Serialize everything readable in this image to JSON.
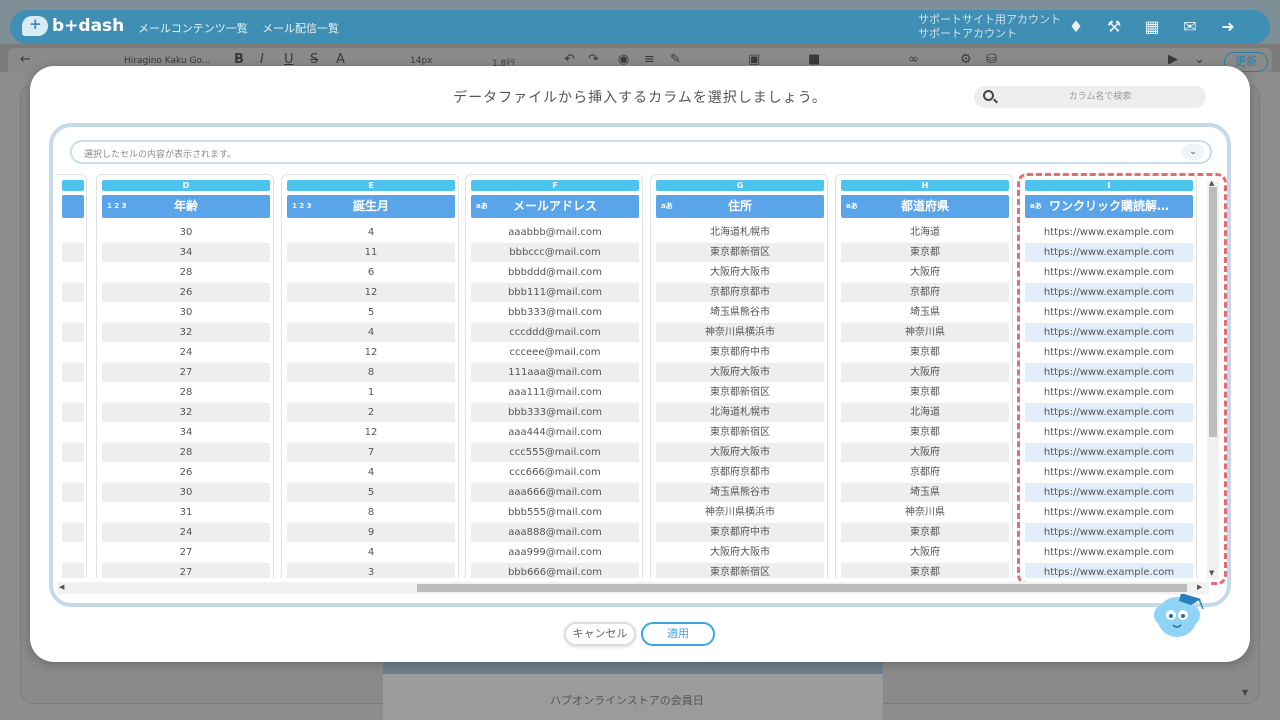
{
  "app": {
    "logo_text": "b+dash",
    "nav": [
      "メールコンテンツ一覧",
      "メール配信一覧"
    ],
    "account_line1": "サポートサイト用アカウント",
    "account_line2": "サポートアカウント",
    "top_icons": [
      "bell-icon",
      "wrench-icon",
      "grid-icon",
      "chat-icon",
      "logout-icon"
    ]
  },
  "toolbar": {
    "font_family": "Hiragino Kaku Go...",
    "font_size": "14px",
    "line_height": "1.8行",
    "update_label": "更新"
  },
  "background": {
    "panel_text": "ハプオンラインストアの会員日"
  },
  "modal": {
    "title": "データファイルから挿入するカラムを選択しましょう。",
    "search_placeholder": "カラム名で検索",
    "cell_preview_placeholder": "選択したセルの内容が表示されます。",
    "cancel_label": "キャンセル",
    "apply_label": "適用",
    "selected_column": "I",
    "columns": [
      {
        "letter": "D",
        "type": "1 2 3",
        "header": "年齢",
        "cells": [
          "30",
          "34",
          "28",
          "26",
          "30",
          "32",
          "24",
          "27",
          "28",
          "32",
          "34",
          "28",
          "26",
          "30",
          "31",
          "24",
          "27",
          "27"
        ]
      },
      {
        "letter": "E",
        "type": "1 2 3",
        "header": "誕生月",
        "cells": [
          "4",
          "11",
          "6",
          "12",
          "5",
          "4",
          "12",
          "8",
          "1",
          "2",
          "12",
          "7",
          "4",
          "5",
          "8",
          "9",
          "4",
          "3"
        ]
      },
      {
        "letter": "F",
        "type": "aあ",
        "header": "メールアドレス",
        "cells": [
          "aaabbb@mail.com",
          "bbbccc@mail.com",
          "bbbddd@mail.com",
          "bbb111@mail.com",
          "bbb333@mail.com",
          "cccddd@mail.com",
          "ccceee@mail.com",
          "111aaa@mail.com",
          "aaa111@mail.com",
          "bbb333@mail.com",
          "aaa444@mail.com",
          "ccc555@mail.com",
          "ccc666@mail.com",
          "aaa666@mail.com",
          "bbb555@mail.com",
          "aaa888@mail.com",
          "aaa999@mail.com",
          "bbb666@mail.com"
        ]
      },
      {
        "letter": "G",
        "type": "aあ",
        "header": "住所",
        "cells": [
          "北海道札幌市",
          "東京都新宿区",
          "大阪府大阪市",
          "京都府京都市",
          "埼玉県熊谷市",
          "神奈川県横浜市",
          "東京都府中市",
          "大阪府大阪市",
          "東京都新宿区",
          "北海道札幌市",
          "東京都新宿区",
          "大阪府大阪市",
          "京都府京都市",
          "埼玉県熊谷市",
          "神奈川県横浜市",
          "東京都府中市",
          "大阪府大阪市",
          "東京都新宿区"
        ]
      },
      {
        "letter": "H",
        "type": "aあ",
        "header": "都道府県",
        "cells": [
          "北海道",
          "東京都",
          "大阪府",
          "京都府",
          "埼玉県",
          "神奈川県",
          "東京都",
          "大阪府",
          "東京都",
          "北海道",
          "東京都",
          "大阪府",
          "京都府",
          "埼玉県",
          "神奈川県",
          "東京都",
          "大阪府",
          "東京都"
        ]
      },
      {
        "letter": "I",
        "type": "aあ",
        "header": "ワンクリック購読解…",
        "cells": [
          "https://www.example.com",
          "https://www.example.com",
          "https://www.example.com",
          "https://www.example.com",
          "https://www.example.com",
          "https://www.example.com",
          "https://www.example.com",
          "https://www.example.com",
          "https://www.example.com",
          "https://www.example.com",
          "https://www.example.com",
          "https://www.example.com",
          "https://www.example.com",
          "https://www.example.com",
          "https://www.example.com",
          "https://www.example.com",
          "https://www.example.com",
          "https://www.example.com"
        ]
      }
    ]
  },
  "colors": {
    "accent": "#3aa4e8",
    "column_letter": "#4cc4ee",
    "column_header": "#5aa4ea",
    "selection_dashed": "#e56b75",
    "app_header": "#3f8eb3"
  }
}
